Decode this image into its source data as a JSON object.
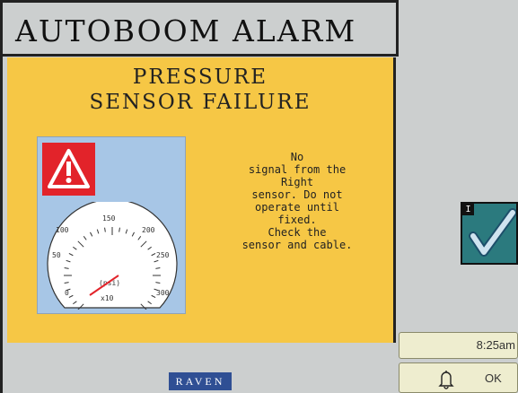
{
  "header": {
    "title": "AUTOBOOM ALARM"
  },
  "alarm": {
    "heading_line1": "PRESSURE",
    "heading_line2": "SENSOR FAILURE",
    "message": "No\nsignal from the\nRight\nsensor. Do not\noperate until\nfixed.\nCheck the\nsensor and cable."
  },
  "gauge": {
    "ticks": [
      "0",
      "50",
      "100",
      "150",
      "200",
      "250",
      "300"
    ],
    "unit": "(psi)",
    "multiplier": "x10"
  },
  "side": {
    "tag": "I"
  },
  "status": {
    "time": "8:25am"
  },
  "actions": {
    "ok_label": "OK"
  },
  "footer": {
    "logo_text": "RAVEN"
  },
  "colors": {
    "panel": "#f6c745",
    "gauge_bg": "#a7c6e6",
    "warning_red": "#e2232a",
    "needle_red": "#e2232a",
    "check_teal": "#2b7a7e",
    "brand_blue": "#2f4f94",
    "button_bg": "#eeedcf"
  }
}
